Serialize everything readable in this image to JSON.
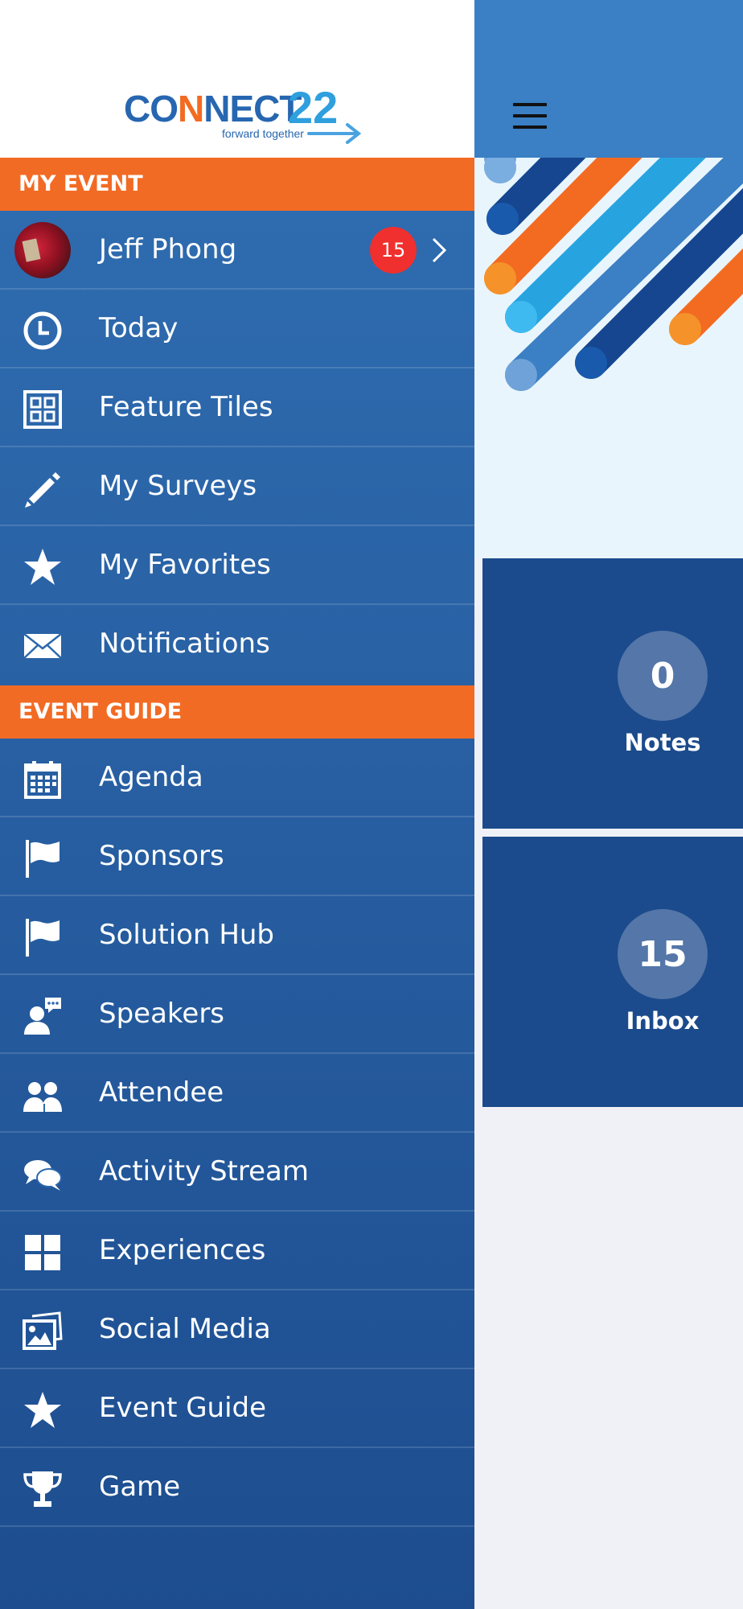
{
  "app": {
    "logo": {
      "word_prefix": "CO",
      "word_o": "N",
      "word_mid": "N",
      "word_suffix": "ECT",
      "number": "22",
      "tagline": "forward together"
    }
  },
  "colors": {
    "accent_orange": "#f26b24",
    "drawer_top": "#3170b4",
    "drawer_bottom": "#1d4d8f",
    "tile_blue": "#1b4b8c",
    "badge_red": "#f0302e"
  },
  "drawer": {
    "sections": {
      "my_event": "MY EVENT",
      "event_guide": "EVENT GUIDE"
    },
    "profile": {
      "name": "Jeff Phong",
      "badge_count": "15"
    },
    "my_event_items": [
      {
        "label": "Today",
        "icon": "clock-icon"
      },
      {
        "label": "Feature Tiles",
        "icon": "grid-tiles-icon"
      },
      {
        "label": "My Surveys",
        "icon": "pencil-icon"
      },
      {
        "label": "My Favorites",
        "icon": "star-icon"
      },
      {
        "label": "Notifications",
        "icon": "envelope-icon"
      }
    ],
    "event_guide_items": [
      {
        "label": "Agenda",
        "icon": "calendar-icon"
      },
      {
        "label": "Sponsors",
        "icon": "flag-icon"
      },
      {
        "label": "Solution Hub",
        "icon": "flag-icon"
      },
      {
        "label": "Speakers",
        "icon": "speaker-icon"
      },
      {
        "label": "Attendee",
        "icon": "people-icon"
      },
      {
        "label": "Activity Stream",
        "icon": "chat-bubbles-icon"
      },
      {
        "label": "Experiences",
        "icon": "windows-grid-icon"
      },
      {
        "label": "Social Media",
        "icon": "photos-icon"
      },
      {
        "label": "Event Guide",
        "icon": "star-icon"
      },
      {
        "label": "Game",
        "icon": "trophy-icon"
      }
    ]
  },
  "content": {
    "tiles": {
      "notes": {
        "count": "0",
        "label": "Notes"
      },
      "inbox": {
        "count": "15",
        "label": "Inbox"
      }
    }
  }
}
